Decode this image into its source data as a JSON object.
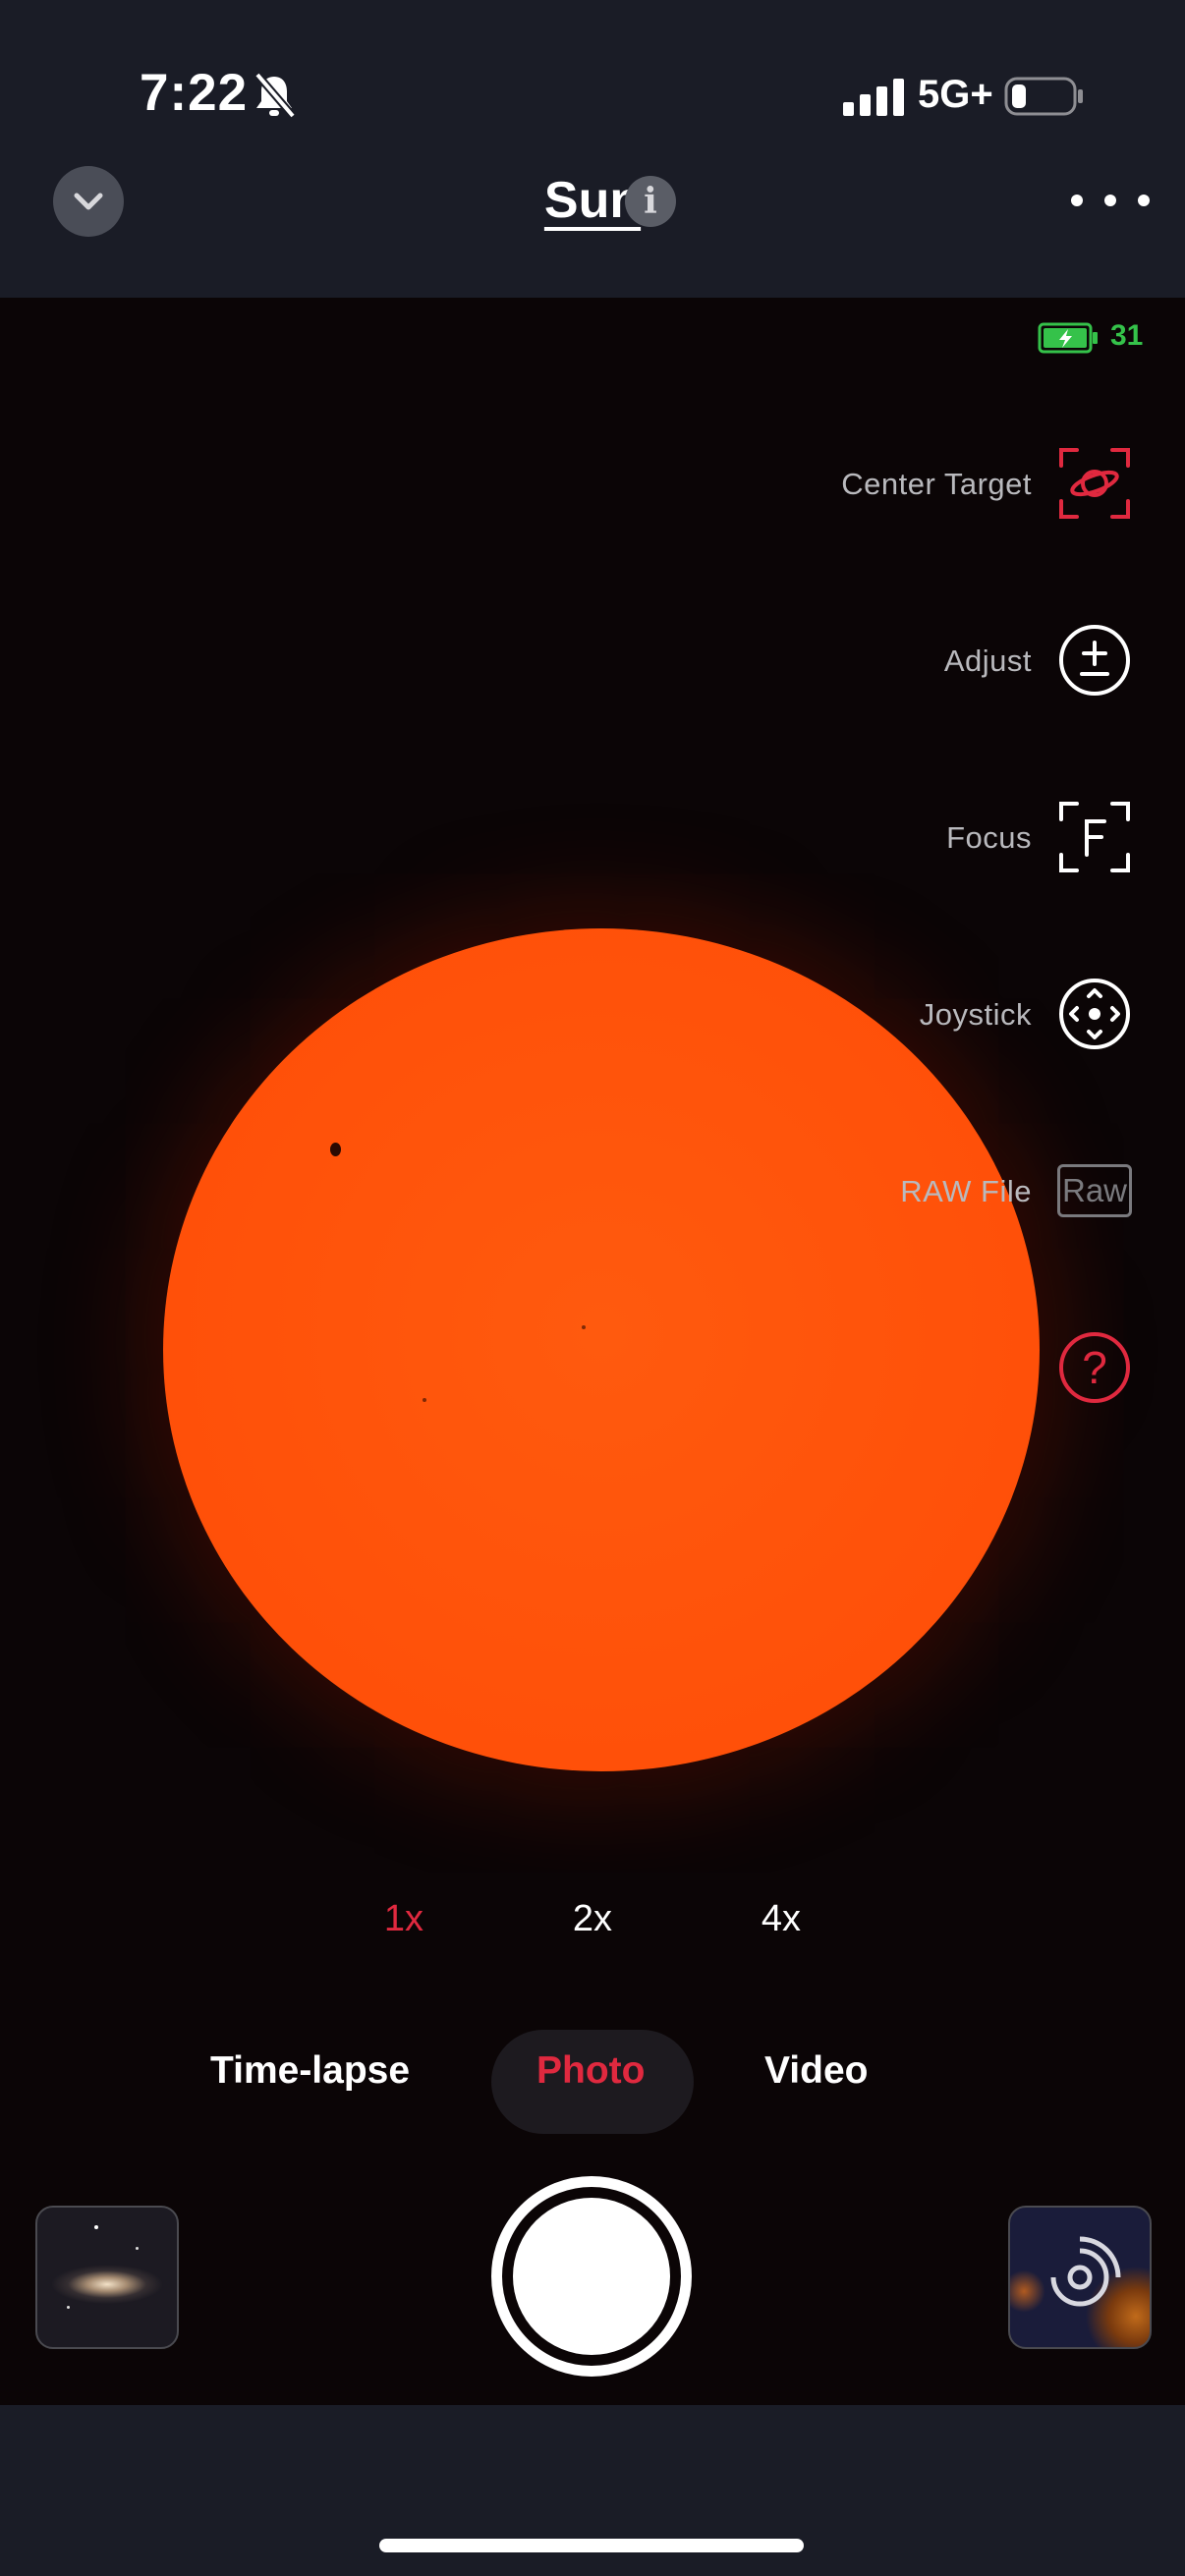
{
  "status_bar": {
    "time": "7:22",
    "network": "5G+"
  },
  "header": {
    "title": "Sun",
    "info_glyph": "i"
  },
  "viewfinder": {
    "scope_battery_level": "31",
    "tools": [
      {
        "label": "Center Target",
        "icon": "center-target-icon",
        "color": "#e0293f"
      },
      {
        "label": "Adjust",
        "icon": "plus-minus-icon",
        "color": "#ffffff"
      },
      {
        "label": "Focus",
        "icon": "focus-icon",
        "color": "#ffffff"
      },
      {
        "label": "Joystick",
        "icon": "joystick-icon",
        "color": "#ffffff"
      },
      {
        "label": "RAW File",
        "icon": "raw-icon",
        "icon_text": "Raw",
        "color": "#7a7a7e"
      },
      {
        "label": "",
        "icon": "help-icon",
        "icon_text": "?",
        "color": "#e0293f"
      }
    ],
    "zoom_levels": [
      "1x",
      "2x",
      "4x"
    ],
    "selected_zoom": "1x"
  },
  "modes": {
    "items": [
      "Time-lapse",
      "Photo",
      "Video"
    ],
    "selected": "Photo"
  },
  "colors": {
    "accent": "#e0293f",
    "sun": "#ff5009",
    "background": "#1a1c26",
    "battery_green": "#35c24a"
  }
}
